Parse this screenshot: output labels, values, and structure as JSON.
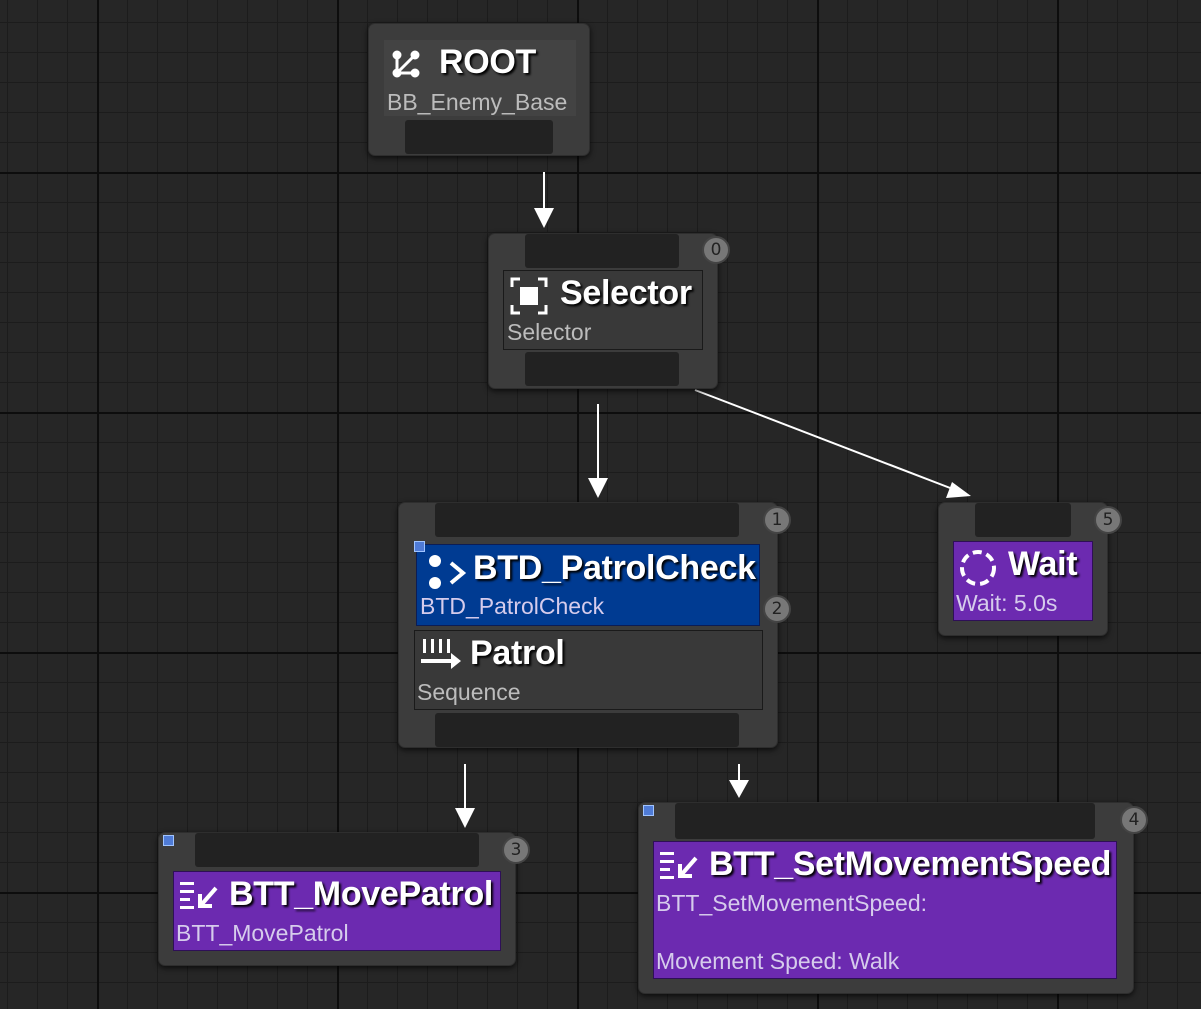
{
  "graph": {
    "root": {
      "title": "ROOT",
      "subtitle": "BB_Enemy_Base"
    },
    "selector": {
      "index": "0",
      "title": "Selector",
      "subtitle": "Selector"
    },
    "patrol_sequence": {
      "index": "1",
      "decorator": {
        "index": "2",
        "title": "BTD_PatrolCheck",
        "subtitle": "BTD_PatrolCheck"
      },
      "title": "Patrol",
      "subtitle": "Sequence"
    },
    "wait": {
      "index": "5",
      "title": "Wait",
      "subtitle": "Wait: 5.0s"
    },
    "move_patrol": {
      "index": "3",
      "title": "BTT_MovePatrol",
      "subtitle": "BTT_MovePatrol"
    },
    "set_speed": {
      "index": "4",
      "title": "BTT_SetMovementSpeed",
      "subtitle": "BTT_SetMovementSpeed:",
      "detail": "Movement Speed: Walk"
    }
  },
  "icons": {
    "root": "branch-icon",
    "selector": "selector-icon",
    "decorator": "decorator-icon",
    "sequence": "sequence-icon",
    "wait": "wait-icon",
    "task": "task-icon"
  },
  "colors": {
    "composite": "#393939",
    "decorator": "#003b92",
    "task": "#6c2ab0",
    "background": "#262626"
  }
}
